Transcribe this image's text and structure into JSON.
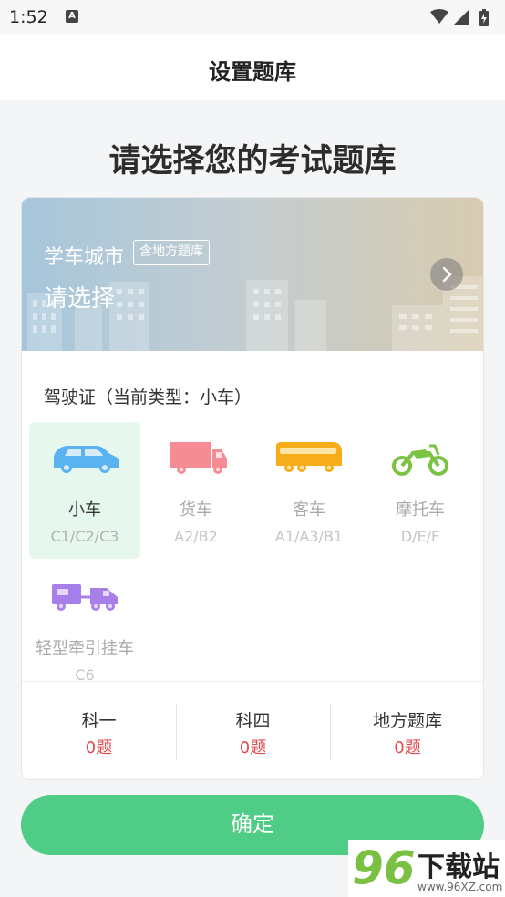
{
  "status_bar": {
    "time": "1:52",
    "notification_icon": "A"
  },
  "header": {
    "title": "设置题库"
  },
  "page_heading": "请选择您的考试题库",
  "banner": {
    "title": "学车城市",
    "tag": "含地方题库",
    "select_label": "请选择"
  },
  "license": {
    "title": "驾驶证（当前类型：小车）",
    "vehicles": [
      {
        "name": "小车",
        "code": "C1/C2/C3",
        "icon": "car-icon",
        "color": "#5ab2f0",
        "selected": true
      },
      {
        "name": "货车",
        "code": "A2/B2",
        "icon": "truck-icon",
        "color": "#f58b93",
        "selected": false
      },
      {
        "name": "客车",
        "code": "A1/A3/B1",
        "icon": "bus-icon",
        "color": "#f7ad1a",
        "selected": false
      },
      {
        "name": "摩托车",
        "code": "D/E/F",
        "icon": "motorcycle-icon",
        "color": "#7cc243",
        "selected": false
      },
      {
        "name": "轻型牵引挂车",
        "code": "C6",
        "icon": "trailer-icon",
        "color": "#a680e8",
        "selected": false
      }
    ]
  },
  "banks": [
    {
      "label": "科一",
      "count": "0题"
    },
    {
      "label": "科四",
      "count": "0题"
    },
    {
      "label": "地方题库",
      "count": "0题"
    }
  ],
  "confirm_label": "确定",
  "watermark": {
    "logo": "96",
    "text": "下载站",
    "url": "www.96XZ.com"
  },
  "colors": {
    "accent": "#4fcc86",
    "count_red": "#e5484d",
    "selected_bg": "#e6f8ee"
  }
}
